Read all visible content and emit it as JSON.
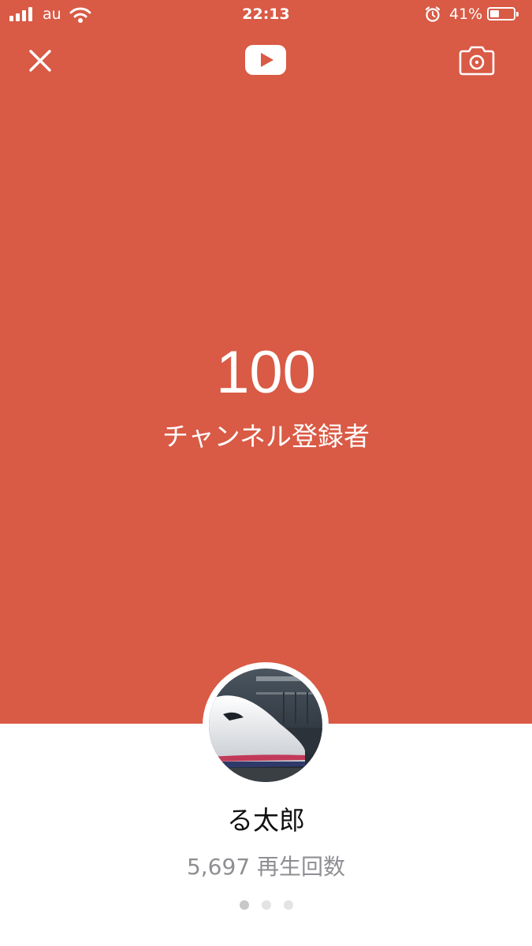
{
  "status_bar": {
    "carrier": "au",
    "time": "22:13",
    "battery_percent": "41%",
    "battery_level": 0.41,
    "icons": [
      "signal-icon",
      "wifi-icon",
      "alarm-icon",
      "battery-icon"
    ]
  },
  "toolbar": {
    "icons": [
      "close-icon",
      "youtube-logo-icon",
      "camera-icon"
    ]
  },
  "hero": {
    "count": "100",
    "label": "チャンネル登録者",
    "background_color": "#d95a45"
  },
  "channel": {
    "name": "る太郎",
    "views": "5,697 再生回数"
  },
  "pager": {
    "pages": 3,
    "active_index": 0
  }
}
